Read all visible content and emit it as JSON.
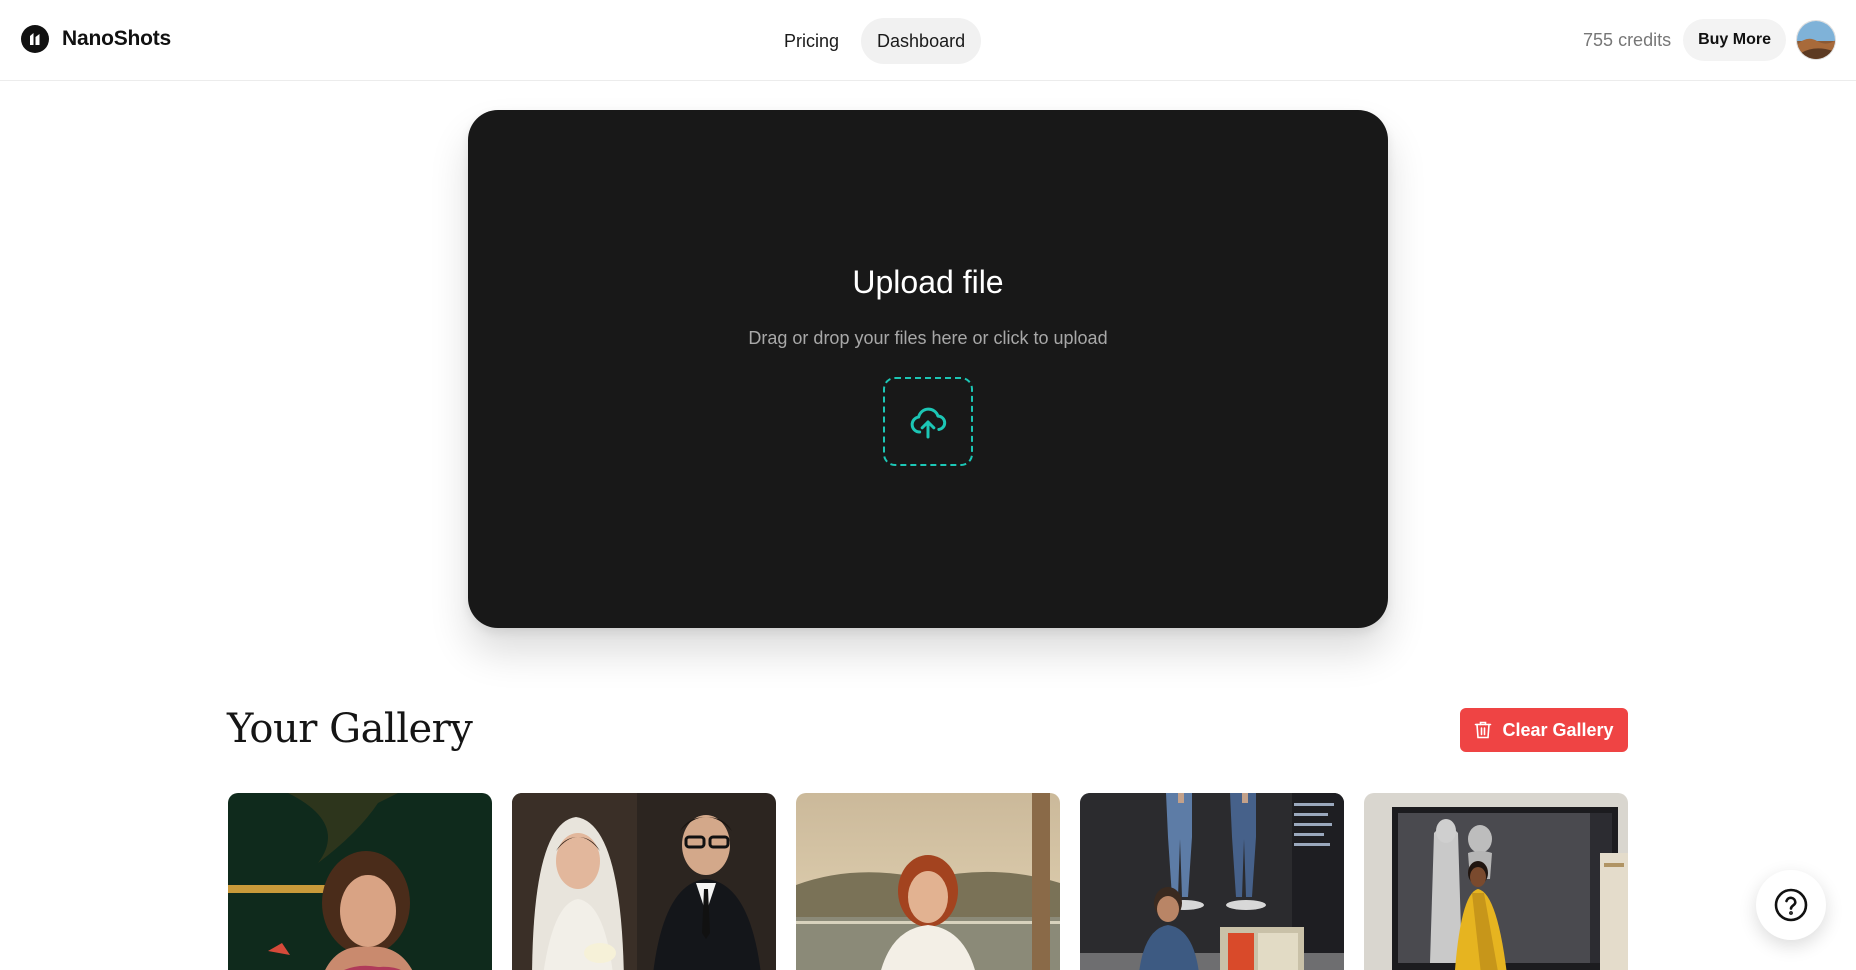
{
  "brand": {
    "name": "NanoShots"
  },
  "nav": [
    {
      "label": "Pricing",
      "active": false
    },
    {
      "label": "Dashboard",
      "active": true
    }
  ],
  "account": {
    "credits": "755 credits",
    "buy_label": "Buy More"
  },
  "upload": {
    "title": "Upload file",
    "subtitle": "Drag or drop your files here or click to upload",
    "accent": "#1cc6b5"
  },
  "gallery": {
    "title": "Your Gallery",
    "clear_label": "Clear Gallery",
    "clear_color": "#ef4444",
    "items": [
      {
        "icon": "portrait-photo"
      },
      {
        "icon": "wedding-photo"
      },
      {
        "icon": "landscape-portrait-photo"
      },
      {
        "icon": "3d-figure-photo"
      },
      {
        "icon": "saree-figure-photo"
      }
    ]
  },
  "help": {
    "icon": "question-icon"
  }
}
